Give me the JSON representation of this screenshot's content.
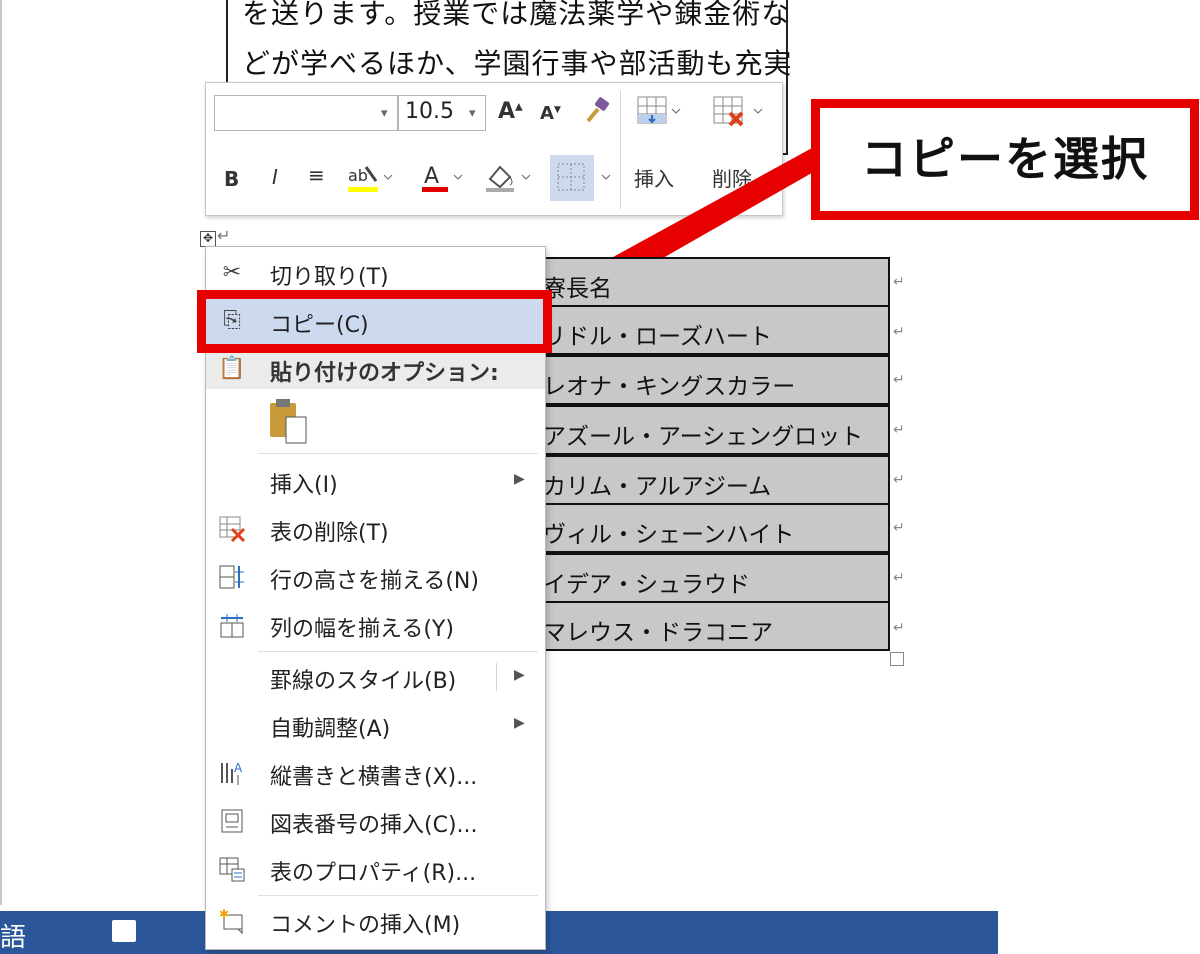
{
  "document": {
    "line1": "を送ります。授業では魔法薬学や錬金術な",
    "line2": "どが学べるほか、学園行事や部活動も充実"
  },
  "mini_toolbar": {
    "font_name": "",
    "font_size": "10.5",
    "insert_label": "挿入",
    "delete_label": "削除",
    "highlight_color": "#ffff00",
    "font_color": "#e00000"
  },
  "callout": {
    "text": "コピーを選択",
    "color": "#e60000"
  },
  "table": {
    "rows": [
      "寮長名",
      "リドル・ローズハート",
      "レオナ・キングスカラー",
      "アズール・アーシェングロット",
      "カリム・アルアジーム",
      "ヴィル・シェーンハイト",
      "イデア・シュラウド",
      "マレウス・ドラコニア"
    ],
    "cell_mark": "↵"
  },
  "context_menu": {
    "items": [
      {
        "label": "切り取り(T)",
        "icon": "scissors-icon"
      },
      {
        "label": "コピー(C)",
        "icon": "copy-icon"
      },
      {
        "label": "貼り付けのオプション:",
        "icon": "paste-icon"
      },
      {
        "label": "挿入(I)",
        "icon": ""
      },
      {
        "label": "表の削除(T)",
        "icon": "delete-table-icon"
      },
      {
        "label": "行の高さを揃える(N)",
        "icon": "distribute-rows-icon"
      },
      {
        "label": "列の幅を揃える(Y)",
        "icon": "distribute-columns-icon"
      },
      {
        "label": "罫線のスタイル(B)",
        "icon": ""
      },
      {
        "label": "自動調整(A)",
        "icon": ""
      },
      {
        "label": "縦書きと横書き(X)...",
        "icon": "text-direction-icon"
      },
      {
        "label": "図表番号の挿入(C)...",
        "icon": "caption-icon"
      },
      {
        "label": "表のプロパティ(R)...",
        "icon": "table-properties-icon"
      },
      {
        "label": "コメントの挿入(M)",
        "icon": "comment-icon"
      }
    ],
    "highlight_color": "#cdd9ee"
  },
  "statusbar": {
    "language": "語",
    "color": "#2b579a"
  }
}
